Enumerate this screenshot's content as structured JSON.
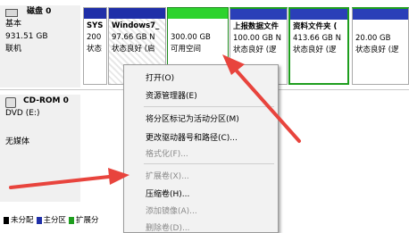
{
  "disk0": {
    "name": "磁盘 0",
    "type": "基本",
    "size": "931.51 GB",
    "status": "联机",
    "volumes": [
      {
        "line1": "SYS",
        "line2": "200",
        "line3": "状态"
      },
      {
        "line1": "Windows7_",
        "line2": "97.66 GB N",
        "line3": "状态良好 (启"
      },
      {
        "line1": "",
        "line2": "300.00 GB",
        "line3": "可用空间"
      },
      {
        "line1": "上报数据文件",
        "line2": "100.00 GB N",
        "line3": "状态良好 (逻"
      },
      {
        "line1": "资料文件夹 (",
        "line2": "413.66 GB N",
        "line3": "状态良好 (逻"
      },
      {
        "line1": "",
        "line2": "20.00 GB",
        "line3": "状态良好 (逻"
      }
    ]
  },
  "cdrom0": {
    "name": "CD-ROM 0",
    "type": "DVD (E:)",
    "status": "无媒体"
  },
  "context_menu": {
    "open": "打开(O)",
    "explore": "资源管理器(E)",
    "mark_active": "将分区标记为活动分区(M)",
    "change_letter": "更改驱动器号和路径(C)...",
    "format": "格式化(F)...",
    "extend": "扩展卷(X)...",
    "shrink": "压缩卷(H)...",
    "add_mirror": "添加镜像(A)...",
    "delete": "删除卷(D)..."
  },
  "legend": {
    "unallocated": "未分配",
    "primary": "主分区",
    "extended": "扩展分"
  },
  "colors": {
    "unallocated": "#000000",
    "primary": "#1f2fa8",
    "extended": "#1e9e1e",
    "free_space": "#2dd32d",
    "logical": "#2a3fb8",
    "arrow": "#e8443d"
  }
}
